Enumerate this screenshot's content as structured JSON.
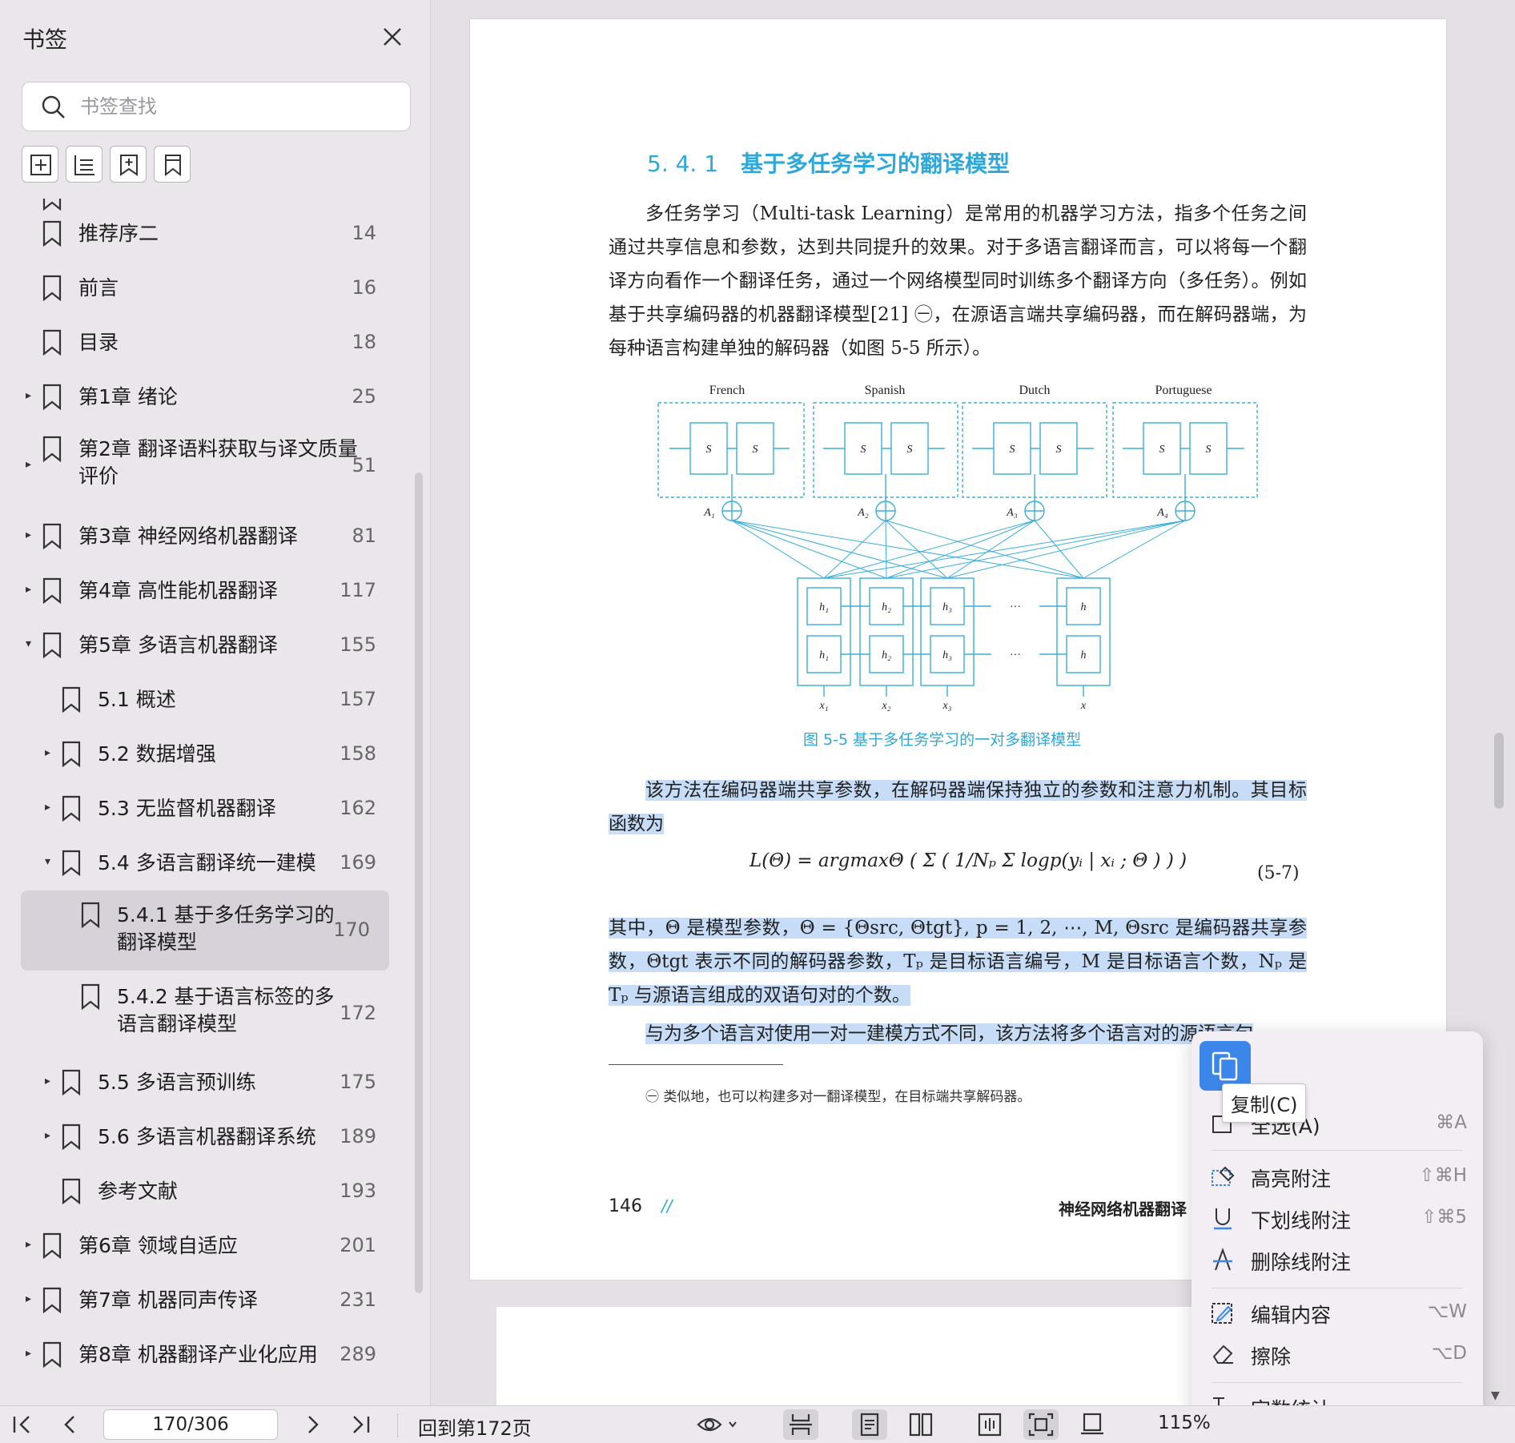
{
  "sidebar": {
    "title": "书签",
    "search_placeholder": "书签查找",
    "items": [
      {
        "label": "推荐序二",
        "page": "14",
        "level": 0,
        "arrow": ""
      },
      {
        "label": "前言",
        "page": "16",
        "level": 0,
        "arrow": ""
      },
      {
        "label": "目录",
        "page": "18",
        "level": 0,
        "arrow": ""
      },
      {
        "label": "第1章 绪论",
        "page": "25",
        "level": 0,
        "arrow": "▸"
      },
      {
        "label": "第2章 翻译语料获取与译文质量",
        "label2": "评价",
        "page": "51",
        "level": 0,
        "arrow": "▸"
      },
      {
        "label": "第3章 神经网络机器翻译",
        "page": "81",
        "level": 0,
        "arrow": "▸"
      },
      {
        "label": "第4章 高性能机器翻译",
        "page": "117",
        "level": 0,
        "arrow": "▸"
      },
      {
        "label": "第5章 多语言机器翻译",
        "page": "155",
        "level": 0,
        "arrow": "▾"
      },
      {
        "label": "5.1 概述",
        "page": "157",
        "level": 1,
        "arrow": ""
      },
      {
        "label": "5.2 数据增强",
        "page": "158",
        "level": 1,
        "arrow": "▸"
      },
      {
        "label": "5.3 无监督机器翻译",
        "page": "162",
        "level": 1,
        "arrow": "▸"
      },
      {
        "label": "5.4 多语言翻译统一建模",
        "page": "169",
        "level": 1,
        "arrow": "▾"
      },
      {
        "label": "5.4.1 基于多任务学习的",
        "label2": "翻译模型",
        "page": "170",
        "level": 2,
        "arrow": ""
      },
      {
        "label": "5.4.2 基于语言标签的多",
        "label2": "语言翻译模型",
        "page": "172",
        "level": 2,
        "arrow": ""
      },
      {
        "label": "5.5 多语言预训练",
        "page": "175",
        "level": 1,
        "arrow": "▸"
      },
      {
        "label": "5.6 多语言机器翻译系统",
        "page": "189",
        "level": 1,
        "arrow": "▸"
      },
      {
        "label": "参考文献",
        "page": "193",
        "level": 1,
        "arrow": ""
      },
      {
        "label": "第6章 领域自适应",
        "page": "201",
        "level": 0,
        "arrow": "▸"
      },
      {
        "label": "第7章 机器同声传译",
        "page": "231",
        "level": 0,
        "arrow": "▸"
      },
      {
        "label": "第8章 机器翻译产业化应用",
        "page": "289",
        "level": 0,
        "arrow": "▸"
      }
    ]
  },
  "doc": {
    "section_number": "5. 4. 1",
    "section_title": "基于多任务学习的翻译模型",
    "para1": "多任务学习（Multi-task Learning）是常用的机器学习方法，指多个任务之间通过共享信息和参数，达到共同提升的效果。对于多语言翻译而言，可以将每一个翻译方向看作一个翻译任务，通过一个网络模型同时训练多个翻译方向（多任务）。例如基于共享编码器的机器翻译模型[21] ㊀，在源语言端共享编码器，而在解码器端，为每种语言构建单独的解码器（如图 5-5 所示）。",
    "figure_languages": [
      "French",
      "Spanish",
      "Dutch",
      "Portuguese"
    ],
    "figure_caption": "图 5-5   基于多任务学习的一对多翻译模型",
    "para2": "该方法在编码器端共享参数，在解码器端保持独立的参数和注意力机制。其目标函数为",
    "formula": "L(Θ) = argmaxΘ ( Σ ( 1/Nₚ Σ logp(yᵢ | xᵢ ; Θ ) ) )",
    "formula_number": "(5-7)",
    "para3": "其中，Θ 是模型参数，Θ = {Θsrc, Θtgt}, p = 1, 2, ⋯, M, Θsrc 是编码器共享参数，Θtgt 表示不同的解码器参数，Tₚ 是目标语言编号，M 是目标语言个数，Nₚ 是 Tₚ 与源语言组成的双语句对的个数。",
    "para4": "与为多个语言对使用一对一建模方式不同，该方法将多个语言对的源语言句",
    "footnote": "㊀  类似地，也可以构建多对一翻译模型，在目标端共享解码器。",
    "page_number": "146",
    "page_slashes": "//",
    "book_title": "神经网络机器翻译"
  },
  "context_menu": {
    "copy_tooltip": "复制(C)",
    "items": [
      {
        "label": "全选(A)",
        "shortcut": "⌘A"
      },
      {
        "label": "高亮附注",
        "shortcut": "⇧⌘H"
      },
      {
        "label": "下划线附注",
        "shortcut": "⇧⌘5"
      },
      {
        "label": "删除线附注",
        "shortcut": ""
      },
      {
        "label": "编辑内容",
        "shortcut": "⌥W"
      },
      {
        "label": "擦除",
        "shortcut": "⌥D"
      },
      {
        "label": "字数统计",
        "shortcut": ""
      }
    ]
  },
  "bottom_bar": {
    "page_indicator": "170/306",
    "back_to": "回到第172页",
    "zoom": "115%"
  },
  "colors": {
    "accent_blue": "#2ea8d8",
    "highlight": "#c7dcf6",
    "menu_primary": "#3b86e8"
  }
}
